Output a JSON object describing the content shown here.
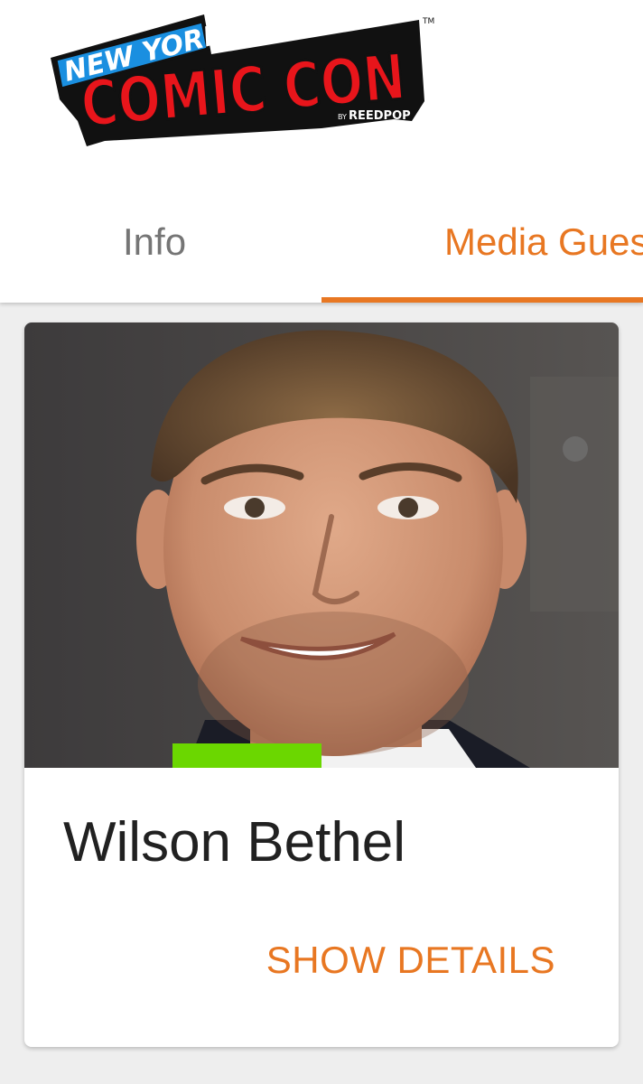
{
  "logo": {
    "line1": "NEW YORK",
    "line2": "COMIC CON",
    "byline": "BY",
    "brand": "REEDPOP",
    "trademark": "TM"
  },
  "tabs": [
    {
      "label": "Info",
      "active": false
    },
    {
      "label": "Media Guests",
      "active": true
    }
  ],
  "guest_card": {
    "name": "Wilson Bethel",
    "action_label": "SHOW DETAILS",
    "photo_icon": "guest-portrait"
  },
  "colors": {
    "accent": "#e87722",
    "tag": "#6bd700",
    "logo_red": "#e8151b",
    "logo_blue": "#1a8fe0"
  }
}
